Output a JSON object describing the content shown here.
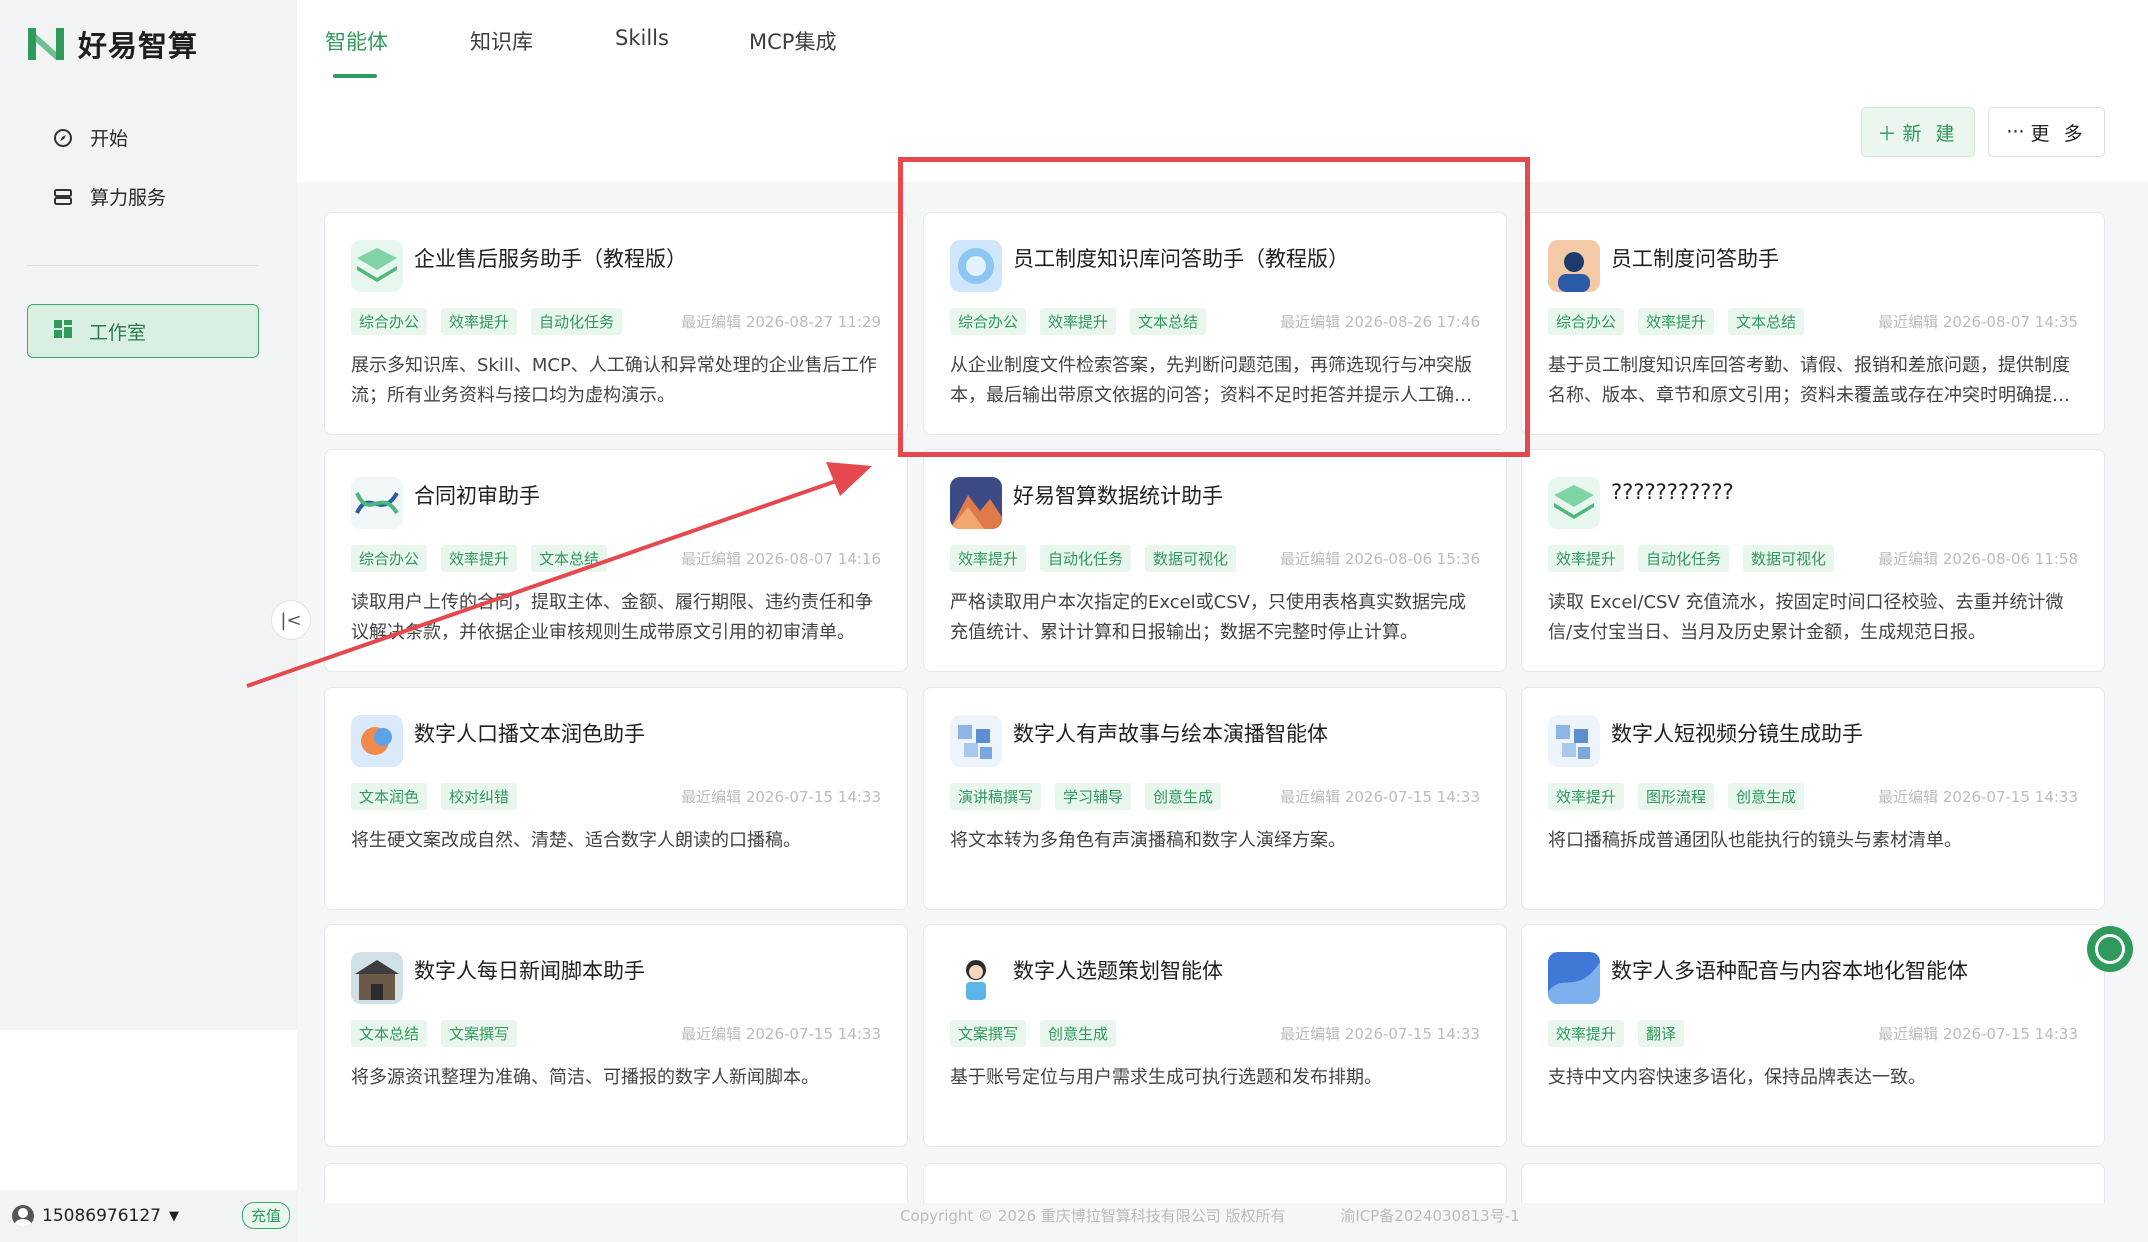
{
  "brand": {
    "name": "好易智算"
  },
  "sidebar": {
    "items": [
      {
        "label": "开始",
        "icon": "compass-icon"
      },
      {
        "label": "算力服务",
        "icon": "server-icon"
      }
    ],
    "workroom": {
      "label": "工作室",
      "icon": "grid-icon"
    },
    "user": {
      "phone": "15086976127",
      "recharge": "充值"
    }
  },
  "tabs": [
    {
      "label": "智能体",
      "active": true
    },
    {
      "label": "知识库",
      "active": false
    },
    {
      "label": "Skills",
      "active": false
    },
    {
      "label": "MCP集成",
      "active": false
    }
  ],
  "toolbar": {
    "new_label": "新 建",
    "new_icon": "plus-icon",
    "more_label": "更 多",
    "more_icon": "ellipsis-icon"
  },
  "cards": [
    {
      "title": "企业售后服务助手（教程版）",
      "tags": [
        "综合办公",
        "效率提升",
        "自动化任务"
      ],
      "edited": "最近编辑 2026-08-27 11:29",
      "desc": "展示多知识库、Skill、MCP、人工确认和异常处理的企业售后工作流；所有业务资料与接口均为虚构演示。",
      "icon": "green-layers-icon"
    },
    {
      "title": "员工制度知识库问答助手（教程版）",
      "tags": [
        "综合办公",
        "效率提升",
        "文本总结"
      ],
      "edited": "最近编辑 2026-08-26 17:46",
      "desc": "从企业制度文件检索答案，先判断问题范围，再筛选现行与冲突版本，最后输出带原文依据的问答；资料不足时拒答并提示人工确认。",
      "icon": "blue-ring-icon"
    },
    {
      "title": "员工制度问答助手",
      "tags": [
        "综合办公",
        "效率提升",
        "文本总结"
      ],
      "edited": "最近编辑 2026-08-07 14:35",
      "desc": "基于员工制度知识库回答考勤、请假、报销和差旅问题，提供制度名称、版本、章节和原文引用；资料未覆盖或存在冲突时明确提示。",
      "icon": "person-avatar-icon"
    },
    {
      "title": "合同初审助手",
      "tags": [
        "综合办公",
        "效率提升",
        "文本总结"
      ],
      "edited": "最近编辑 2026-08-07 14:16",
      "desc": "读取用户上传的合同，提取主体、金额、履行期限、违约责任和争议解决条款，并依据企业审核规则生成带原文引用的初审清单。",
      "icon": "dna-icon"
    },
    {
      "title": "好易智算数据统计助手",
      "tags": [
        "效率提升",
        "自动化任务",
        "数据可视化"
      ],
      "edited": "最近编辑 2026-08-06 15:36",
      "desc": "严格读取用户本次指定的Excel或CSV，只使用表格真实数据完成充值统计、累计计算和日报输出；数据不完整时停止计算。",
      "icon": "mountain-icon"
    },
    {
      "title": "???????????",
      "tags": [
        "效率提升",
        "自动化任务",
        "数据可视化"
      ],
      "edited": "最近编辑 2026-08-06 11:58",
      "desc": "读取 Excel/CSV 充值流水，按固定时间口径校验、去重并统计微信/支付宝当日、当月及历史累计金额，生成规范日报。",
      "icon": "green-layers-icon"
    },
    {
      "title": "数字人口播文本润色助手",
      "tags": [
        "文本润色",
        "校对纠错"
      ],
      "edited": "最近编辑 2026-07-15 14:33",
      "desc": "将生硬文案改成自然、清楚、适合数字人朗读的口播稿。",
      "icon": "orange-blob-icon"
    },
    {
      "title": "数字人有声故事与绘本演播智能体",
      "tags": [
        "演讲稿撰写",
        "学习辅导",
        "创意生成"
      ],
      "edited": "最近编辑 2026-07-15 14:33",
      "desc": "将文本转为多角色有声演播稿和数字人演绎方案。",
      "icon": "cubes-icon"
    },
    {
      "title": "数字人短视频分镜生成助手",
      "tags": [
        "效率提升",
        "图形流程",
        "创意生成"
      ],
      "edited": "最近编辑 2026-07-15 14:33",
      "desc": "将口播稿拆成普通团队也能执行的镜头与素材清单。",
      "icon": "cubes-icon"
    },
    {
      "title": "数字人每日新闻脚本助手",
      "tags": [
        "文本总结",
        "文案撰写"
      ],
      "edited": "最近编辑 2026-07-15 14:33",
      "desc": "将多源资讯整理为准确、简洁、可播报的数字人新闻脚本。",
      "icon": "building-icon"
    },
    {
      "title": "数字人选题策划智能体",
      "tags": [
        "文案撰写",
        "创意生成"
      ],
      "edited": "最近编辑 2026-07-15 14:33",
      "desc": "基于账号定位与用户需求生成可执行选题和发布排期。",
      "icon": "character-icon"
    },
    {
      "title": "数字人多语种配音与内容本地化智能体",
      "tags": [
        "效率提升",
        "翻译"
      ],
      "edited": "最近编辑 2026-07-15 14:33",
      "desc": "支持中文内容快速多语化，保持品牌表达一致。",
      "icon": "blue-wave-icon"
    }
  ],
  "footer": {
    "copyright": "Copyright © 2026 重庆博拉智算科技有限公司 版权所有",
    "icp": "渝ICP备2024030813号-1"
  },
  "colors": {
    "accent": "#2f9a5c",
    "highlight": "#e5484d"
  }
}
